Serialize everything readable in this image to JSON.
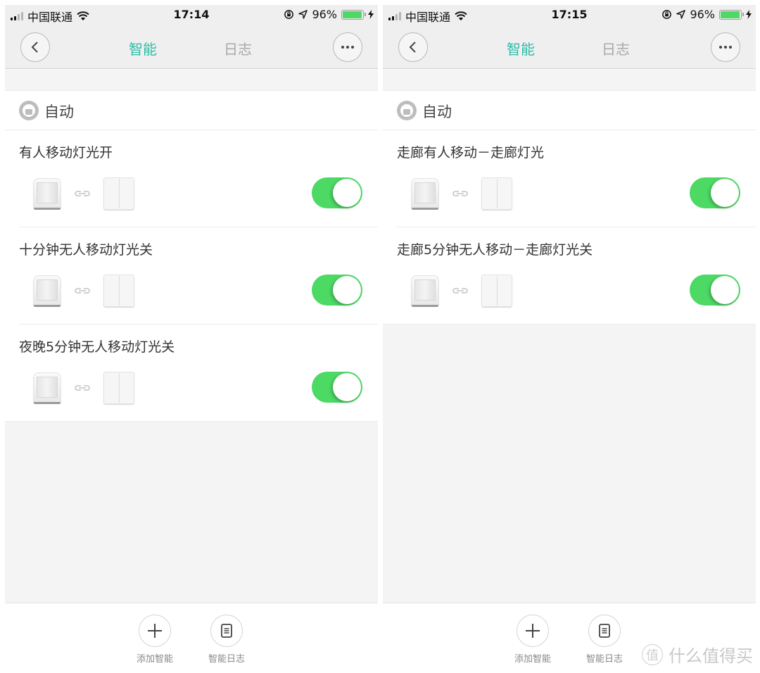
{
  "screens": [
    {
      "status": {
        "carrier": "中国联通",
        "time": "17:14",
        "battery": "96%",
        "battery_level": 0.96
      },
      "nav": {
        "tab_active": "智能",
        "tab_inactive": "日志"
      },
      "section": {
        "title": "自动",
        "icon": "robot-icon"
      },
      "rules": [
        {
          "name": "有人移动灯光开",
          "trigger_device": "motion-sensor",
          "action_device": "wall-switch",
          "enabled": true
        },
        {
          "name": "十分钟无人移动灯光关",
          "trigger_device": "motion-sensor",
          "action_device": "wall-switch",
          "enabled": true
        },
        {
          "name": "夜晚5分钟无人移动灯光关",
          "trigger_device": "motion-sensor",
          "action_device": "wall-switch",
          "enabled": true
        }
      ],
      "bottom": {
        "add_label": "添加智能",
        "log_label": "智能日志"
      }
    },
    {
      "status": {
        "carrier": "中国联通",
        "time": "17:15",
        "battery": "96%",
        "battery_level": 0.96
      },
      "nav": {
        "tab_active": "智能",
        "tab_inactive": "日志"
      },
      "section": {
        "title": "自动",
        "icon": "robot-icon"
      },
      "rules": [
        {
          "name": "走廊有人移动－走廊灯光",
          "trigger_device": "motion-sensor",
          "action_device": "wall-switch",
          "enabled": true
        },
        {
          "name": "走廊5分钟无人移动－走廊灯光关",
          "trigger_device": "motion-sensor",
          "action_device": "wall-switch",
          "enabled": true
        }
      ],
      "bottom": {
        "add_label": "添加智能",
        "log_label": "智能日志"
      }
    }
  ],
  "watermark": {
    "badge": "值",
    "text": "什么值得买"
  },
  "colors": {
    "accent": "#2ebba4",
    "toggle_on": "#4cd964",
    "battery": "#4cd964"
  }
}
